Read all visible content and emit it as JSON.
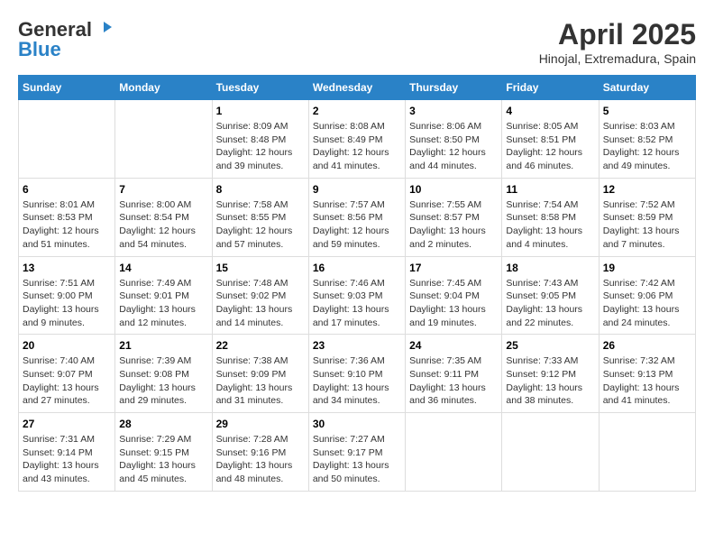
{
  "header": {
    "logo_general": "General",
    "logo_blue": "Blue",
    "month_title": "April 2025",
    "location": "Hinojal, Extremadura, Spain"
  },
  "days_of_week": [
    "Sunday",
    "Monday",
    "Tuesday",
    "Wednesday",
    "Thursday",
    "Friday",
    "Saturday"
  ],
  "weeks": [
    [
      {
        "day": "",
        "sunrise": "",
        "sunset": "",
        "daylight": ""
      },
      {
        "day": "",
        "sunrise": "",
        "sunset": "",
        "daylight": ""
      },
      {
        "day": "1",
        "sunrise": "Sunrise: 8:09 AM",
        "sunset": "Sunset: 8:48 PM",
        "daylight": "Daylight: 12 hours and 39 minutes."
      },
      {
        "day": "2",
        "sunrise": "Sunrise: 8:08 AM",
        "sunset": "Sunset: 8:49 PM",
        "daylight": "Daylight: 12 hours and 41 minutes."
      },
      {
        "day": "3",
        "sunrise": "Sunrise: 8:06 AM",
        "sunset": "Sunset: 8:50 PM",
        "daylight": "Daylight: 12 hours and 44 minutes."
      },
      {
        "day": "4",
        "sunrise": "Sunrise: 8:05 AM",
        "sunset": "Sunset: 8:51 PM",
        "daylight": "Daylight: 12 hours and 46 minutes."
      },
      {
        "day": "5",
        "sunrise": "Sunrise: 8:03 AM",
        "sunset": "Sunset: 8:52 PM",
        "daylight": "Daylight: 12 hours and 49 minutes."
      }
    ],
    [
      {
        "day": "6",
        "sunrise": "Sunrise: 8:01 AM",
        "sunset": "Sunset: 8:53 PM",
        "daylight": "Daylight: 12 hours and 51 minutes."
      },
      {
        "day": "7",
        "sunrise": "Sunrise: 8:00 AM",
        "sunset": "Sunset: 8:54 PM",
        "daylight": "Daylight: 12 hours and 54 minutes."
      },
      {
        "day": "8",
        "sunrise": "Sunrise: 7:58 AM",
        "sunset": "Sunset: 8:55 PM",
        "daylight": "Daylight: 12 hours and 57 minutes."
      },
      {
        "day": "9",
        "sunrise": "Sunrise: 7:57 AM",
        "sunset": "Sunset: 8:56 PM",
        "daylight": "Daylight: 12 hours and 59 minutes."
      },
      {
        "day": "10",
        "sunrise": "Sunrise: 7:55 AM",
        "sunset": "Sunset: 8:57 PM",
        "daylight": "Daylight: 13 hours and 2 minutes."
      },
      {
        "day": "11",
        "sunrise": "Sunrise: 7:54 AM",
        "sunset": "Sunset: 8:58 PM",
        "daylight": "Daylight: 13 hours and 4 minutes."
      },
      {
        "day": "12",
        "sunrise": "Sunrise: 7:52 AM",
        "sunset": "Sunset: 8:59 PM",
        "daylight": "Daylight: 13 hours and 7 minutes."
      }
    ],
    [
      {
        "day": "13",
        "sunrise": "Sunrise: 7:51 AM",
        "sunset": "Sunset: 9:00 PM",
        "daylight": "Daylight: 13 hours and 9 minutes."
      },
      {
        "day": "14",
        "sunrise": "Sunrise: 7:49 AM",
        "sunset": "Sunset: 9:01 PM",
        "daylight": "Daylight: 13 hours and 12 minutes."
      },
      {
        "day": "15",
        "sunrise": "Sunrise: 7:48 AM",
        "sunset": "Sunset: 9:02 PM",
        "daylight": "Daylight: 13 hours and 14 minutes."
      },
      {
        "day": "16",
        "sunrise": "Sunrise: 7:46 AM",
        "sunset": "Sunset: 9:03 PM",
        "daylight": "Daylight: 13 hours and 17 minutes."
      },
      {
        "day": "17",
        "sunrise": "Sunrise: 7:45 AM",
        "sunset": "Sunset: 9:04 PM",
        "daylight": "Daylight: 13 hours and 19 minutes."
      },
      {
        "day": "18",
        "sunrise": "Sunrise: 7:43 AM",
        "sunset": "Sunset: 9:05 PM",
        "daylight": "Daylight: 13 hours and 22 minutes."
      },
      {
        "day": "19",
        "sunrise": "Sunrise: 7:42 AM",
        "sunset": "Sunset: 9:06 PM",
        "daylight": "Daylight: 13 hours and 24 minutes."
      }
    ],
    [
      {
        "day": "20",
        "sunrise": "Sunrise: 7:40 AM",
        "sunset": "Sunset: 9:07 PM",
        "daylight": "Daylight: 13 hours and 27 minutes."
      },
      {
        "day": "21",
        "sunrise": "Sunrise: 7:39 AM",
        "sunset": "Sunset: 9:08 PM",
        "daylight": "Daylight: 13 hours and 29 minutes."
      },
      {
        "day": "22",
        "sunrise": "Sunrise: 7:38 AM",
        "sunset": "Sunset: 9:09 PM",
        "daylight": "Daylight: 13 hours and 31 minutes."
      },
      {
        "day": "23",
        "sunrise": "Sunrise: 7:36 AM",
        "sunset": "Sunset: 9:10 PM",
        "daylight": "Daylight: 13 hours and 34 minutes."
      },
      {
        "day": "24",
        "sunrise": "Sunrise: 7:35 AM",
        "sunset": "Sunset: 9:11 PM",
        "daylight": "Daylight: 13 hours and 36 minutes."
      },
      {
        "day": "25",
        "sunrise": "Sunrise: 7:33 AM",
        "sunset": "Sunset: 9:12 PM",
        "daylight": "Daylight: 13 hours and 38 minutes."
      },
      {
        "day": "26",
        "sunrise": "Sunrise: 7:32 AM",
        "sunset": "Sunset: 9:13 PM",
        "daylight": "Daylight: 13 hours and 41 minutes."
      }
    ],
    [
      {
        "day": "27",
        "sunrise": "Sunrise: 7:31 AM",
        "sunset": "Sunset: 9:14 PM",
        "daylight": "Daylight: 13 hours and 43 minutes."
      },
      {
        "day": "28",
        "sunrise": "Sunrise: 7:29 AM",
        "sunset": "Sunset: 9:15 PM",
        "daylight": "Daylight: 13 hours and 45 minutes."
      },
      {
        "day": "29",
        "sunrise": "Sunrise: 7:28 AM",
        "sunset": "Sunset: 9:16 PM",
        "daylight": "Daylight: 13 hours and 48 minutes."
      },
      {
        "day": "30",
        "sunrise": "Sunrise: 7:27 AM",
        "sunset": "Sunset: 9:17 PM",
        "daylight": "Daylight: 13 hours and 50 minutes."
      },
      {
        "day": "",
        "sunrise": "",
        "sunset": "",
        "daylight": ""
      },
      {
        "day": "",
        "sunrise": "",
        "sunset": "",
        "daylight": ""
      },
      {
        "day": "",
        "sunrise": "",
        "sunset": "",
        "daylight": ""
      }
    ]
  ]
}
